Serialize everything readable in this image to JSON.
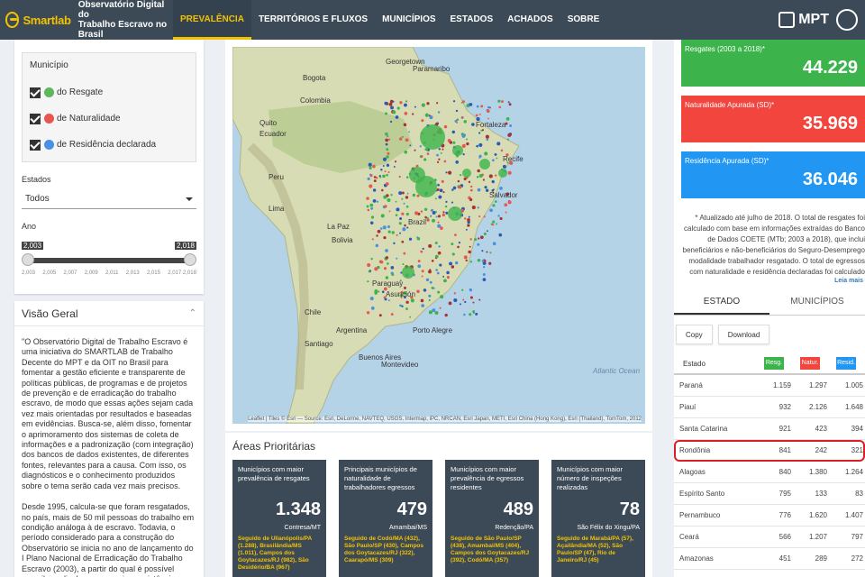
{
  "header": {
    "brand_name_a": "Smart",
    "brand_name_b": "lab",
    "brand_line1": "Observatório Digital do",
    "brand_line2": "Trabalho Escravo no Brasil",
    "nav": [
      "PREVALÊNCIA",
      "TERRITÓRIOS E FLUXOS",
      "MUNICÍPIOS",
      "ESTADOS",
      "ACHADOS",
      "SOBRE"
    ],
    "active_nav": "PREVALÊNCIA",
    "right_logo": "MPT"
  },
  "filters": {
    "municipio_label": "Município",
    "checks": [
      {
        "label": "do Resgate",
        "color": "#5cb85c"
      },
      {
        "label": "de Naturalidade",
        "color": "#e8574f"
      },
      {
        "label": "de Residência declarada",
        "color": "#4a90e2"
      }
    ],
    "estados_label": "Estados",
    "estados_value": "Todos",
    "ano_label": "Ano",
    "ano_min": "2,003",
    "ano_max": "2,018",
    "ticks": [
      "2,003",
      "2,005",
      "2,007",
      "2,009",
      "2,011",
      "2,013",
      "2,015",
      "2,017 2,018"
    ]
  },
  "overview": {
    "title": "Visão Geral",
    "p1": "\"O Observatório Digital de Trabalho Escravo é uma iniciativa do SMARTLAB de Trabalho Decente do MPT e da OIT no Brasil para fomentar a gestão eficiente e transparente de políticas públicas, de programas e de projetos de prevenção e de erradicação do trabalho escravo, de modo que essas ações sejam cada vez mais orientadas por resultados e baseadas em evidências. Busca-se, além disso, fomentar o aprimoramento dos sistemas de coleta de informações e a padronização (com integração) dos bancos de dados existentes, de diferentes fontes, relevantes para a causa. Com isso, os diagnósticos e o conhecimento produzidos sobre o tema serão cada vez mais precisos.",
    "p2": "Desde 1995, calcula-se que foram resgatados, no país, mais de 50 mil pessoas do trabalho em condição análoga à de escravo. Todavia, o período considerado para a construção do Observatório se inicia no ano de lançamento do I Plano Nacional de Erradicação do Trabalho Escravo (2003), a partir do qual é possível compilar e divulgar, com mais consistência, as informações do Seguro-Desemprego do"
  },
  "map": {
    "labels": [
      {
        "t": "Georgetown"
      },
      {
        "t": "Paramaribo"
      },
      {
        "t": "Bogota"
      },
      {
        "t": "Colombia"
      },
      {
        "t": "Quito"
      },
      {
        "t": "Ecuador"
      },
      {
        "t": "Peru"
      },
      {
        "t": "Lima"
      },
      {
        "t": "Bolivia"
      },
      {
        "t": "La Paz"
      },
      {
        "t": "Brazil"
      },
      {
        "t": "Salvador"
      },
      {
        "t": "Asunción"
      },
      {
        "t": "Paraguay"
      },
      {
        "t": "Porto Alegre"
      },
      {
        "t": "Chile"
      },
      {
        "t": "Argentina"
      },
      {
        "t": "Buenos Aires"
      },
      {
        "t": "Montevideo"
      },
      {
        "t": "Fortaleza"
      },
      {
        "t": "Recife"
      },
      {
        "t": "Santiago"
      },
      {
        "t": "Atlantic Ocean"
      }
    ],
    "attribution": "Leaflet | Tiles © Esri — Source: Esri, DeLorme, NAVTEQ, USGS, Intermap, iPC, NRCAN, Esri Japan, METI, Esri China (Hong Kong), Esri (Thailand), TomTom, 2012"
  },
  "priority": {
    "title": "Áreas Prioritárias",
    "cards": [
      {
        "title": "Municípios com maior prevalência de resgates",
        "value": "1.348",
        "sub": "Contresa/MT",
        "desc": "Seguido de Ulianópolis/PA (1.288), Brasilândia/MS (1.011), Campos dos Goytacazes/RJ (982), São Desidério/BA (967)"
      },
      {
        "title": "Principais municípios de naturalidade de trabalhadores egressos",
        "value": "479",
        "sub": "Amambai/MS",
        "desc": "Seguido de Codó/MA (432), São Paulo/SP (430), Campos dos Goytacazes/RJ (322), Caarapó/MS (309)"
      },
      {
        "title": "Municípios com maior prevalência de egressos residentes",
        "value": "489",
        "sub": "Redenção/PA",
        "desc": "Seguido de São Paulo/SP (438), Amambai/MS (404), Campos dos Goytacazes/RJ (392), Codó/MA (357)"
      },
      {
        "title": "Municípios com maior número de inspeções realizadas",
        "value": "78",
        "sub": "São Félix do Xingu/PA",
        "desc": "Seguido de Marabá/PA (57), Açailândia/MA (52), São Paulo/SP (47), Rio de Janeiro/RJ (45)"
      }
    ]
  },
  "stats": [
    {
      "label": "Resgates (2003 a 2018)*",
      "value": "44.229",
      "color": "#3cb44b"
    },
    {
      "label": "Naturalidade Apurada (SD)*",
      "value": "35.969",
      "color": "#f2453d"
    },
    {
      "label": "Residência Apurada (SD)*",
      "value": "36.046",
      "color": "#2196f3"
    }
  ],
  "note": "* Atualizado até julho de 2018. O total de resgates foi calculado com base em informações extraídas do Banco de Dados COETE (MTb; 2003 a 2018), que inclui beneficiários e não-beneficiários do Seguro-Desemprego modalidade trabalhador resgatado. O total de egressos com naturalidade e residência declaradas foi calculado",
  "leia_mais": "Leia mais",
  "tabs": [
    "ESTADO",
    "MUNICÍPIOS"
  ],
  "buttons": [
    "Copy",
    "Download"
  ],
  "table": {
    "headers": [
      "Estado",
      "Resg.",
      "Natur.",
      "Resid."
    ],
    "header_colors": [
      "#3cb44b",
      "#f2453d",
      "#2196f3"
    ],
    "rows": [
      [
        "Paraná",
        "1.159",
        "1.297",
        "1.005"
      ],
      [
        "Piauí",
        "932",
        "2.126",
        "1.648"
      ],
      [
        "Santa Catarina",
        "921",
        "423",
        "394"
      ],
      [
        "Rondônia",
        "841",
        "242",
        "321"
      ],
      [
        "Alagoas",
        "840",
        "1.380",
        "1.264"
      ],
      [
        "Espírito Santo",
        "795",
        "133",
        "83"
      ],
      [
        "Pernambuco",
        "776",
        "1.620",
        "1.407"
      ],
      [
        "Ceará",
        "566",
        "1.207",
        "797"
      ],
      [
        "Amazonas",
        "451",
        "289",
        "272"
      ]
    ],
    "highlighted_row": "Rondônia"
  }
}
